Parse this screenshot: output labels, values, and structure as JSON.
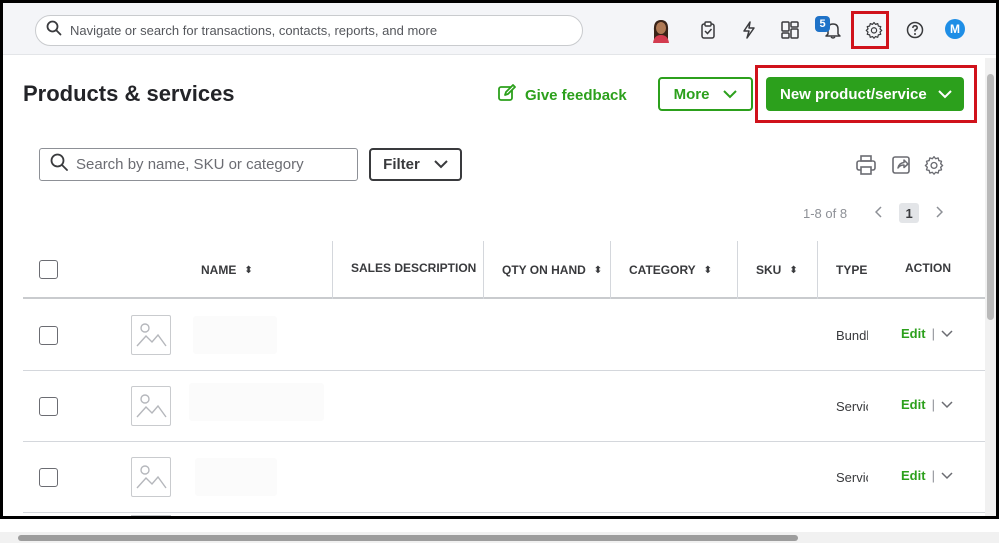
{
  "topbar": {
    "search_placeholder": "Navigate or search for transactions, contacts, reports, and more",
    "notification_count": "5",
    "avatar_initial": "M"
  },
  "header": {
    "title": "Products & services",
    "feedback_label": "Give feedback",
    "more_label": "More",
    "new_label": "New product/service"
  },
  "toolbar": {
    "search_placeholder": "Search by name, SKU or category",
    "filter_label": "Filter"
  },
  "pagination": {
    "range": "1-8 of 8",
    "current_page": "1"
  },
  "table": {
    "columns": [
      "NAME",
      "SALES DESCRIPTION",
      "QTY ON HAND",
      "CATEGORY",
      "SKU",
      "TYPE",
      "ACTION"
    ],
    "rows": [
      {
        "type": "Bundle",
        "action": "Edit"
      },
      {
        "type": "Service",
        "action": "Edit"
      },
      {
        "type": "Service",
        "action": "Edit"
      }
    ]
  },
  "colors": {
    "brand_green": "#2ca01c",
    "highlight_red": "#d0121b",
    "badge_blue": "#1e72c8"
  }
}
